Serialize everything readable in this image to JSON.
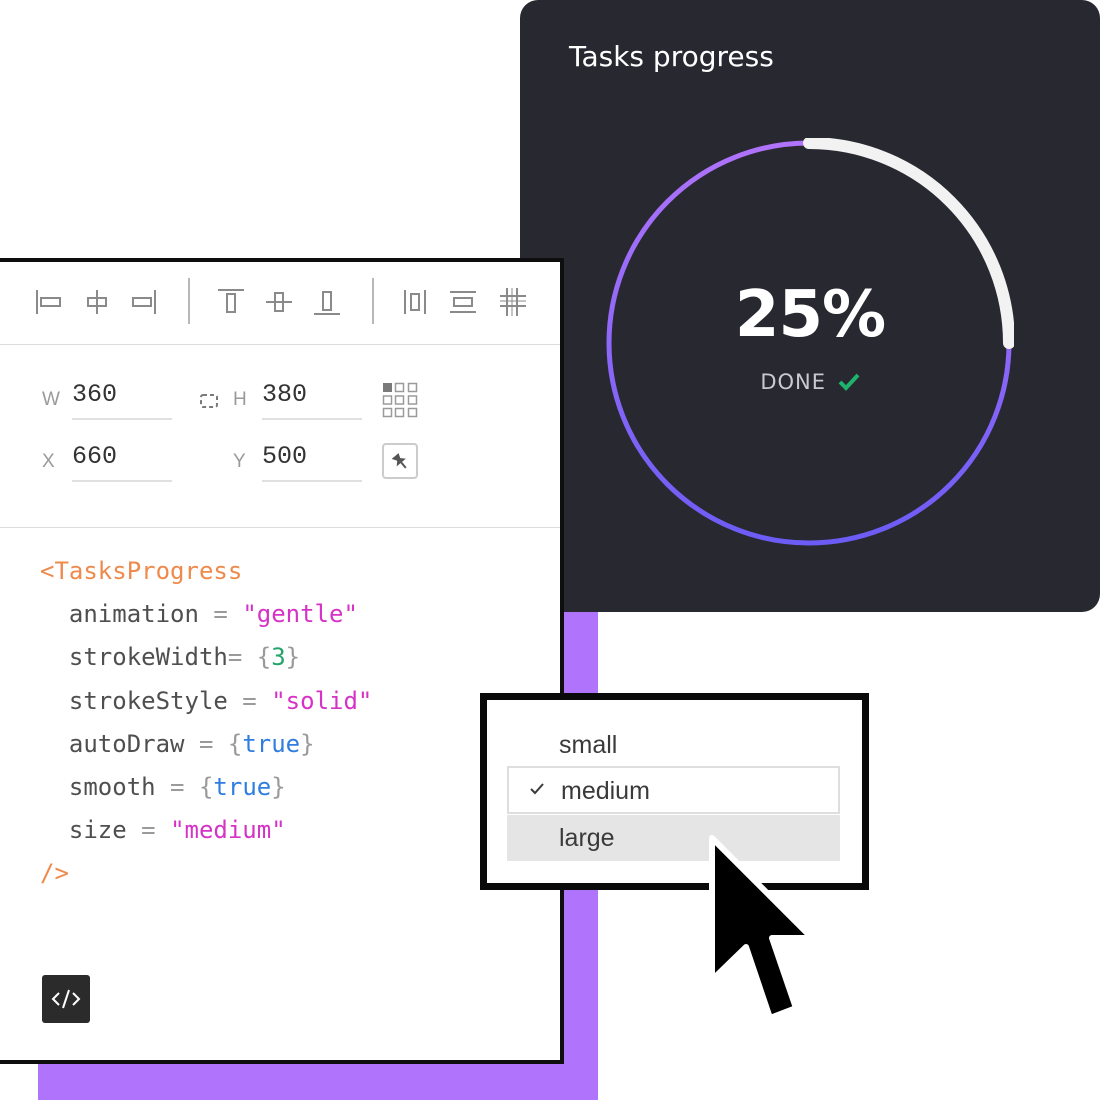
{
  "card": {
    "title": "Tasks progress",
    "percent_text": "25%",
    "progress": 0.25,
    "status": "DONE",
    "status_icon": "check-icon",
    "colors": {
      "background": "#282831",
      "ring_start": "#b073fb",
      "ring_end": "#6c5cf5",
      "remaining": "#f2f2f2",
      "check": "#1fb36b"
    }
  },
  "toolbar": {
    "icons": [
      "align-left-icon",
      "align-center-horizontal-icon",
      "align-right-icon",
      "align-top-icon",
      "align-center-vertical-icon",
      "align-bottom-icon",
      "distribute-horizontal-icon",
      "distribute-vertical-icon",
      "grid-icon"
    ]
  },
  "props": {
    "w_label": "W",
    "w_value": "360",
    "h_label": "H",
    "h_value": "380",
    "x_label": "X",
    "x_value": "660",
    "y_label": "Y",
    "y_value": "500"
  },
  "code": {
    "open_tag": "<TasksProgress",
    "attrs": [
      {
        "name": "animation",
        "op": " = ",
        "value": "\"gentle\"",
        "kind": "str"
      },
      {
        "name": "strokeWidth",
        "op": "= ",
        "value": "3",
        "kind": "num"
      },
      {
        "name": "strokeStyle",
        "op": " = ",
        "value": "\"solid\"",
        "kind": "str"
      },
      {
        "name": "autoDraw",
        "op": " = ",
        "value": "true",
        "kind": "bool"
      },
      {
        "name": "smooth",
        "op": " = ",
        "value": "true",
        "kind": "bool"
      },
      {
        "name": "size",
        "op": " = ",
        "value": "\"medium\"",
        "kind": "str"
      }
    ],
    "close_tag": "/>"
  },
  "code_toggle_icon": "code-icon",
  "dropdown": {
    "options": [
      "small",
      "medium",
      "large"
    ],
    "selected": "medium",
    "hovered": "large"
  },
  "page_accent": "#b073fb"
}
